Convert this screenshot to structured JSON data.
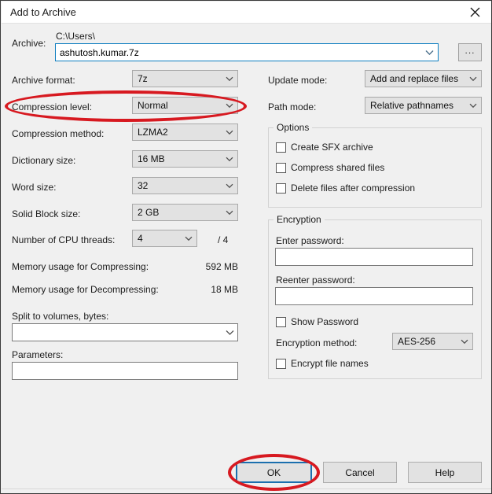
{
  "window": {
    "title": "Add to Archive",
    "close_icon": "close-icon"
  },
  "archive": {
    "label": "Archive:",
    "path_prefix": "C:\\Users\\",
    "value": "ashutosh.kumar.7z",
    "browse_label": "...",
    "dropdown_icon": "chevron-down-icon"
  },
  "left_fields": [
    {
      "label": "Archive format:",
      "value": "7z"
    },
    {
      "label": "Compression level:",
      "value": "Normal"
    },
    {
      "label": "Compression method:",
      "value": "LZMA2"
    },
    {
      "label": "Dictionary size:",
      "value": "16 MB"
    },
    {
      "label": "Word size:",
      "value": "32"
    },
    {
      "label": "Solid Block size:",
      "value": "2 GB"
    },
    {
      "label": "Number of CPU threads:",
      "value": "4"
    }
  ],
  "cpu": {
    "total_suffix": "/ 4"
  },
  "memory": {
    "compress_label": "Memory usage for Compressing:",
    "compress_value": "592 MB",
    "decompress_label": "Memory usage for Decompressing:",
    "decompress_value": "18 MB"
  },
  "split": {
    "label": "Split to volumes, bytes:",
    "value": ""
  },
  "parameters": {
    "label": "Parameters:",
    "value": ""
  },
  "right_fields": [
    {
      "label": "Update mode:",
      "value": "Add and replace files"
    },
    {
      "label": "Path mode:",
      "value": "Relative pathnames"
    }
  ],
  "options": {
    "title": "Options",
    "checkboxes": [
      {
        "label": "Create SFX archive",
        "checked": false
      },
      {
        "label": "Compress shared files",
        "checked": false
      },
      {
        "label": "Delete files after compression",
        "checked": false
      }
    ]
  },
  "encryption": {
    "title": "Encryption",
    "enter_password_label": "Enter password:",
    "enter_password_value": "",
    "reenter_password_label": "Reenter password:",
    "reenter_password_value": "",
    "show_password_label": "Show Password",
    "method_label": "Encryption method:",
    "method_value": "AES-256",
    "encrypt_names_label": "Encrypt file names"
  },
  "buttons": {
    "ok": "OK",
    "cancel": "Cancel",
    "help": "Help"
  },
  "annotations": {
    "accent_color": "#d71920",
    "highlighted": [
      "compression-level-row",
      "ok-button"
    ]
  }
}
